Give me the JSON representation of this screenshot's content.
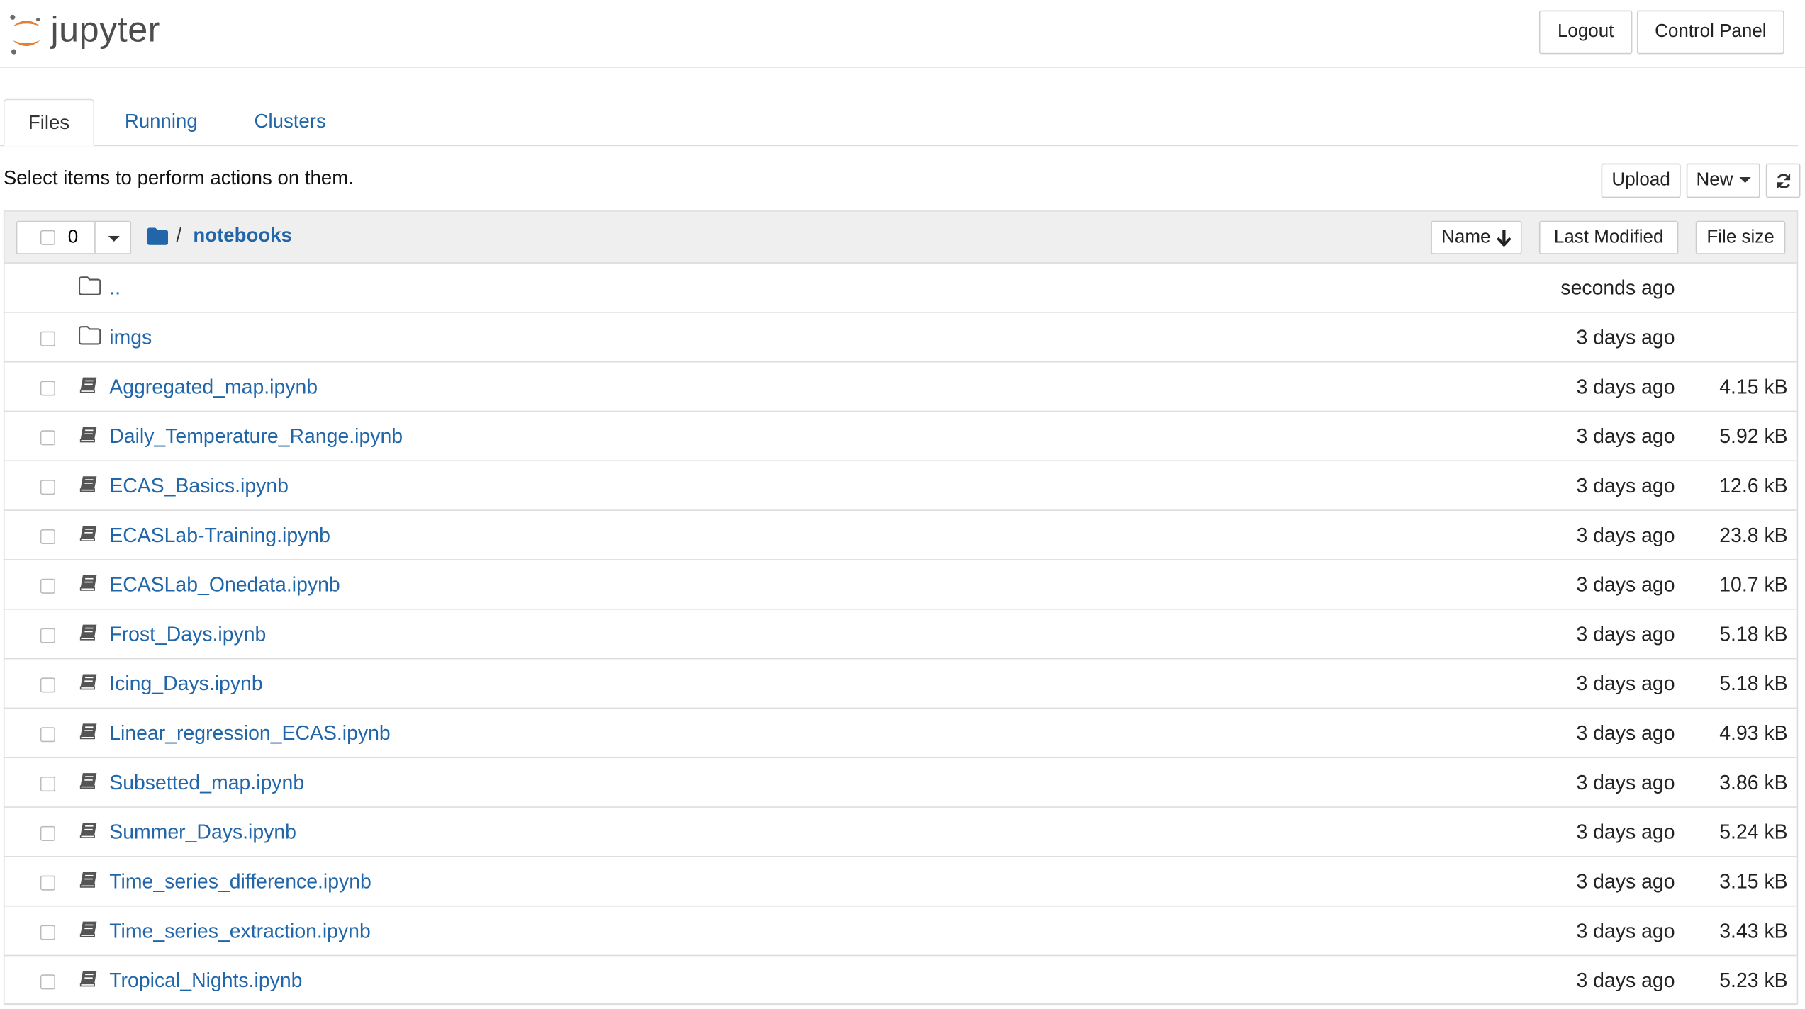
{
  "header": {
    "logo_text": "jupyter",
    "logout_label": "Logout",
    "control_panel_label": "Control Panel"
  },
  "tabs": [
    {
      "label": "Files",
      "active": true
    },
    {
      "label": "Running",
      "active": false
    },
    {
      "label": "Clusters",
      "active": false
    }
  ],
  "toolbar": {
    "message": "Select items to perform actions on them.",
    "upload_label": "Upload",
    "new_label": "New",
    "refresh_icon": "refresh-icon"
  },
  "list_header": {
    "selected_count": "0",
    "breadcrumb_sep": "/",
    "current_dir": "notebooks",
    "col_name": "Name",
    "col_modified": "Last Modified",
    "col_size": "File size"
  },
  "files": [
    {
      "name": "..",
      "type": "folder",
      "modified": "seconds ago",
      "size": ""
    },
    {
      "name": "imgs",
      "type": "folder",
      "modified": "3 days ago",
      "size": ""
    },
    {
      "name": "Aggregated_map.ipynb",
      "type": "notebook",
      "modified": "3 days ago",
      "size": "4.15 kB"
    },
    {
      "name": "Daily_Temperature_Range.ipynb",
      "type": "notebook",
      "modified": "3 days ago",
      "size": "5.92 kB"
    },
    {
      "name": "ECAS_Basics.ipynb",
      "type": "notebook",
      "modified": "3 days ago",
      "size": "12.6 kB"
    },
    {
      "name": "ECASLab-Training.ipynb",
      "type": "notebook",
      "modified": "3 days ago",
      "size": "23.8 kB"
    },
    {
      "name": "ECASLab_Onedata.ipynb",
      "type": "notebook",
      "modified": "3 days ago",
      "size": "10.7 kB"
    },
    {
      "name": "Frost_Days.ipynb",
      "type": "notebook",
      "modified": "3 days ago",
      "size": "5.18 kB"
    },
    {
      "name": "Icing_Days.ipynb",
      "type": "notebook",
      "modified": "3 days ago",
      "size": "5.18 kB"
    },
    {
      "name": "Linear_regression_ECAS.ipynb",
      "type": "notebook",
      "modified": "3 days ago",
      "size": "4.93 kB"
    },
    {
      "name": "Subsetted_map.ipynb",
      "type": "notebook",
      "modified": "3 days ago",
      "size": "3.86 kB"
    },
    {
      "name": "Summer_Days.ipynb",
      "type": "notebook",
      "modified": "3 days ago",
      "size": "5.24 kB"
    },
    {
      "name": "Time_series_difference.ipynb",
      "type": "notebook",
      "modified": "3 days ago",
      "size": "3.15 kB"
    },
    {
      "name": "Time_series_extraction.ipynb",
      "type": "notebook",
      "modified": "3 days ago",
      "size": "3.43 kB"
    },
    {
      "name": "Tropical_Nights.ipynb",
      "type": "notebook",
      "modified": "3 days ago",
      "size": "5.23 kB"
    }
  ],
  "colors": {
    "link": "#2066a8",
    "logo_orange": "#e87d2e",
    "header_bg": "#efefef"
  }
}
